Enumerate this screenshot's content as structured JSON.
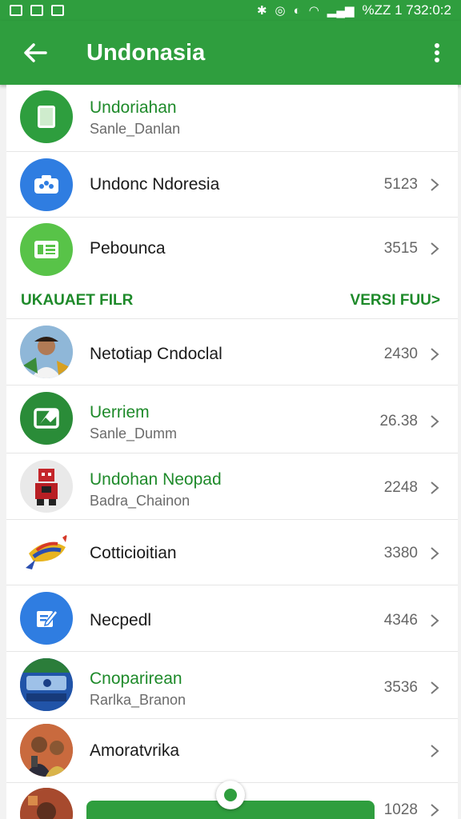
{
  "status_bar": {
    "right_text": "%ZZ 1 732:0:2"
  },
  "app_bar": {
    "title": "Undonasia"
  },
  "section_header": {
    "left": "UKAUAET FILR",
    "right": "VERSI FUU>"
  },
  "items": [
    {
      "primary": "Undoriahan",
      "secondary": "Sanle_Danlan",
      "count": "",
      "icon": "battery-icon",
      "color": "#2e9e3e"
    },
    {
      "primary": "Undonc Ndoresia",
      "secondary": "",
      "count": "5123",
      "icon": "camera-icon",
      "color": "#2f7de1"
    },
    {
      "primary": "Pebounca",
      "secondary": "",
      "count": "3515",
      "icon": "document-icon",
      "color": "#58c348"
    },
    {
      "primary": "Netotiap Cndoclal",
      "secondary": "",
      "count": "2430",
      "icon": "person-photo-icon",
      "color": "#c9d8e6"
    },
    {
      "primary": "Uerriem",
      "secondary": "Sanle_Dumm",
      "count": "26.38",
      "icon": "image-icon",
      "color": "#2a8c38"
    },
    {
      "primary": "Undohan Neopad",
      "secondary": "Badra_Chainon",
      "count": "2248",
      "icon": "robot-icon",
      "color": "#e9e9e9"
    },
    {
      "primary": "Cotticioitian",
      "secondary": "",
      "count": "3380",
      "icon": "kite-icon",
      "color": "#ffffff"
    },
    {
      "primary": "Necpedl",
      "secondary": "",
      "count": "4346",
      "icon": "edit-icon",
      "color": "#2f7de1"
    },
    {
      "primary": "Cnoparirean",
      "secondary": "Rarlka_Branon",
      "count": "3536",
      "icon": "scanner-icon",
      "color": "#2154a8"
    },
    {
      "primary": "Amoratvrika",
      "secondary": "",
      "count": "",
      "icon": "people-photo-icon",
      "color": "#b55a3a"
    },
    {
      "primary": "",
      "secondary": "",
      "count": "1028",
      "icon": "photo-icon",
      "color": "#a74a2e"
    }
  ]
}
